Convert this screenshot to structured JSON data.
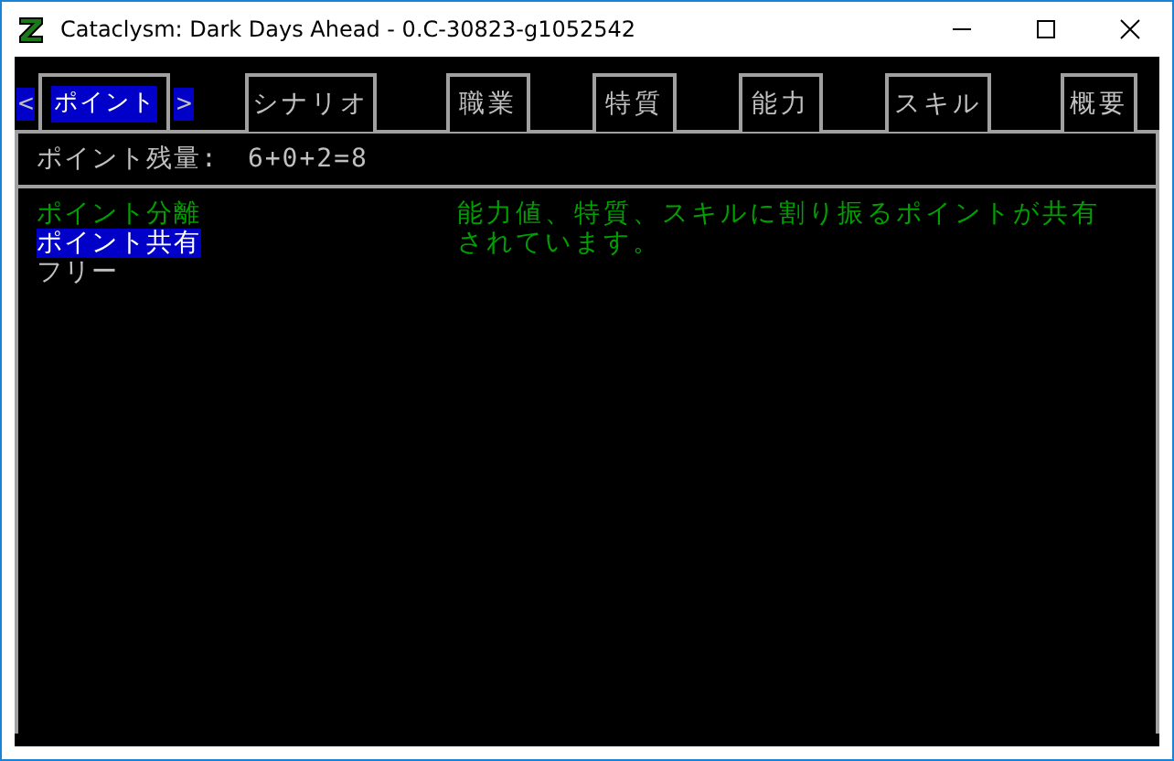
{
  "window": {
    "title": "Cataclysm: Dark Days Ahead - 0.C-30823-g1052542"
  },
  "tabs": [
    {
      "label": "ポイント",
      "selected": true
    },
    {
      "label": "シナリオ",
      "selected": false
    },
    {
      "label": "職業",
      "selected": false
    },
    {
      "label": "特質",
      "selected": false
    },
    {
      "label": "能力",
      "selected": false
    },
    {
      "label": "スキル",
      "selected": false
    },
    {
      "label": "概要",
      "selected": false
    }
  ],
  "tab_arrows": {
    "left": "<",
    "right": ">"
  },
  "points": {
    "label": "ポイント残量:",
    "value": "6+0+2=8"
  },
  "options": [
    {
      "label": "ポイント分離",
      "selected": false,
      "kind": "active"
    },
    {
      "label": "ポイント共有",
      "selected": true,
      "kind": "active"
    },
    {
      "label": "フリー",
      "selected": false,
      "kind": "plain"
    }
  ],
  "description": "能力値、特質、スキルに割り振るポイントが共有されています。"
}
